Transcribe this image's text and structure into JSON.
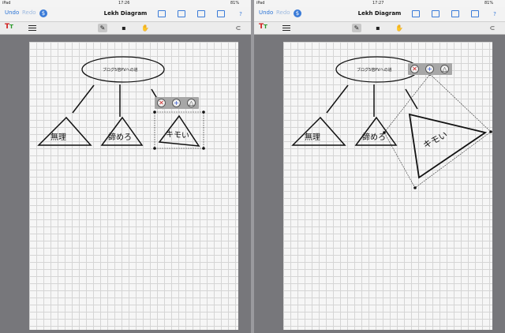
{
  "left": {
    "status": {
      "carrier": "iPad",
      "time": "17:26",
      "battery": "81%"
    },
    "nav": {
      "undo": "Undo",
      "redo": "Redo",
      "dollar": "$",
      "title": "Lekh Diagram",
      "help": "?"
    },
    "toolbar": {
      "tt_a": "T",
      "tt_b": "T"
    },
    "diagram": {
      "oval_text": "ブログ5倍PVへの道",
      "triangles": [
        "無理",
        "諦めろ",
        "キモい"
      ]
    }
  },
  "right": {
    "status": {
      "carrier": "iPad",
      "time": "17:27",
      "battery": "81%"
    },
    "nav": {
      "undo": "Undo",
      "redo": "Redo",
      "dollar": "$",
      "title": "Lekh Diagram",
      "help": "?"
    },
    "toolbar": {
      "tt_a": "T",
      "tt_b": "T"
    },
    "diagram": {
      "oval_text": "ブログ5倍PVへの道",
      "triangles": [
        "無理",
        "諦めろ",
        "キモい"
      ]
    }
  },
  "controls": {
    "delete": "✕",
    "add": "+",
    "shape": "△"
  },
  "icons": [
    "folder-icon",
    "grid-icon",
    "share-icon",
    "document-icon",
    "pen-icon",
    "palette-icon",
    "hand-icon",
    "paperclip-icon"
  ]
}
